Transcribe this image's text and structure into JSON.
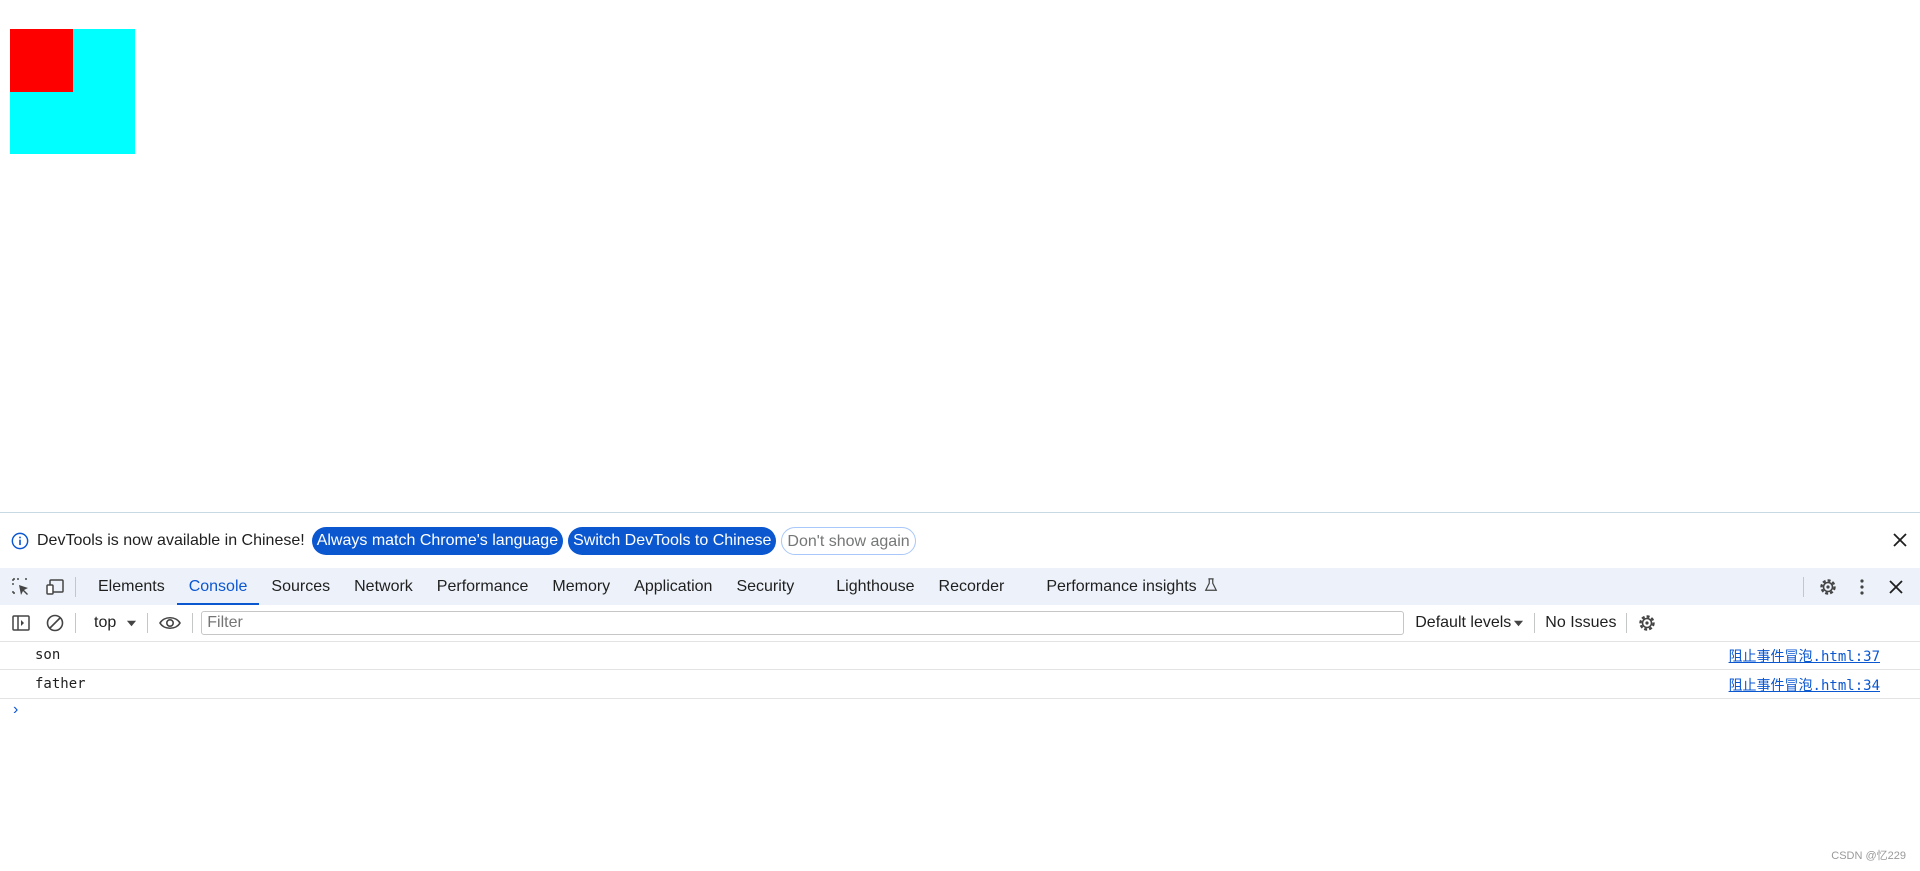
{
  "page": {
    "colors": {
      "father_box": "#00ffff",
      "son_box": "#ff0000"
    },
    "corner_glyph": "⊿"
  },
  "infobar": {
    "message": "DevTools is now available in Chinese!",
    "buttons": [
      "Always match Chrome's language",
      "Switch DevTools to Chinese",
      "Don't show again"
    ]
  },
  "tabs": {
    "items": [
      "Elements",
      "Console",
      "Sources",
      "Network",
      "Performance",
      "Memory",
      "Application",
      "Security",
      "Lighthouse",
      "Recorder",
      "Performance insights"
    ],
    "active": "Console"
  },
  "toolbar": {
    "context": "top",
    "filter_placeholder": "Filter",
    "levels": "Default levels",
    "issues": "No Issues"
  },
  "console": {
    "rows": [
      {
        "message": "son",
        "source": "阻止事件冒泡.html:37"
      },
      {
        "message": "father",
        "source": "阻止事件冒泡.html:34"
      }
    ],
    "prompt": "›"
  },
  "watermark": "CSDN @忆229",
  "colors": {
    "accent": "#0b57d0",
    "tabbar_bg": "#edf2fa"
  }
}
